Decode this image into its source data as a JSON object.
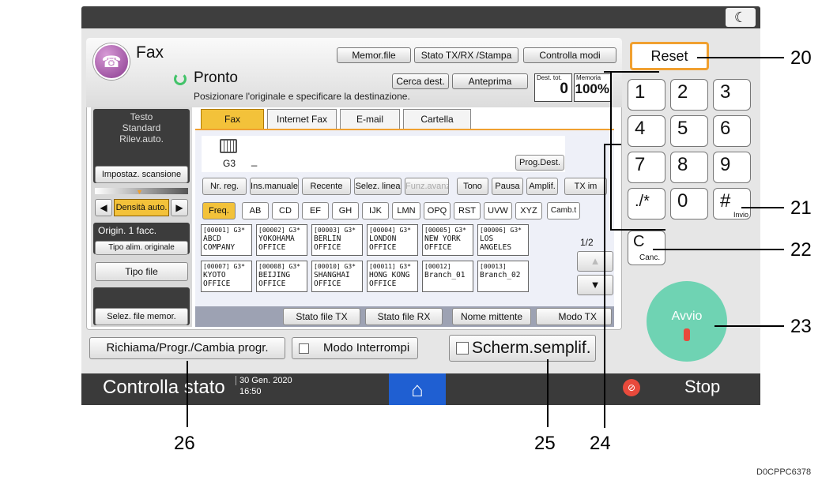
{
  "header": {
    "app": "Fax",
    "status": "Pronto",
    "message": "Posizionare l'originale e specificare la destinazione.",
    "dest_total_label": "Dest. tot.",
    "dest_total_value": "0",
    "memory_label": "Memoria",
    "memory_value": "100%"
  },
  "top_buttons": {
    "memor_file": "Memor.file",
    "stato": "Stato TX/RX /Stampa",
    "controlla": "Controlla modi"
  },
  "search": {
    "cerca": "Cerca dest.",
    "anteprima": "Anteprima"
  },
  "sidebar": {
    "scan_lines": [
      "Testo",
      "Standard",
      "Rilev.auto."
    ],
    "impostaz": "Impostaz. scansione",
    "densita": "Densità auto.",
    "origin": "Origin. 1 facc.",
    "tipo_alim": "Tipo alim. originale",
    "tipo_file": "Tipo file",
    "selez_file": "Selez. file memor."
  },
  "tabs": [
    "Fax",
    "Internet Fax",
    "E-mail",
    "Cartella"
  ],
  "entry": {
    "g3": "G3",
    "cursor": "_",
    "prog_dest": "Prog.Dest."
  },
  "func_buttons": [
    "Nr. reg.",
    "Ins.manuale",
    "Recente",
    "Selez. linea",
    "Funz.avanz.",
    "Tono",
    "Pausa",
    "Amplif.",
    "TX im"
  ],
  "alpha_tabs": [
    "Freq.",
    "AB",
    "CD",
    "EF",
    "GH",
    "IJK",
    "LMN",
    "OPQ",
    "RST",
    "UVW",
    "XYZ",
    "Camb.t"
  ],
  "destinations": [
    {
      "id": "[00001] G3*",
      "name": "ABCD COMPANY"
    },
    {
      "id": "[00002] G3*",
      "name": "YOKOHAMA OFFICE"
    },
    {
      "id": "[00003] G3*",
      "name": "BERLIN OFFICE"
    },
    {
      "id": "[00004] G3*",
      "name": "LONDON OFFICE"
    },
    {
      "id": "[00005] G3*",
      "name": "NEW YORK OFFICE"
    },
    {
      "id": "[00006] G3*",
      "name": "LOS ANGELES"
    },
    {
      "id": "[00007] G3*",
      "name": "KYOTO OFFICE"
    },
    {
      "id": "[00008] G3*",
      "name": "BEIJING OFFICE"
    },
    {
      "id": "[00010] G3*",
      "name": "SHANGHAI OFFICE"
    },
    {
      "id": "[00011] G3*",
      "name": "HONG KONG OFFICE"
    },
    {
      "id": "[00012]",
      "name": "Branch_01"
    },
    {
      "id": "[00013]",
      "name": "Branch_02"
    }
  ],
  "page_indicator": "1/2",
  "bottom_tabs": [
    "Stato file TX",
    "Stato file RX",
    "Nome mittente",
    "Modo TX"
  ],
  "lower_buttons": {
    "richiama": "Richiama/Progr./Cambia progr.",
    "interrompi": "Modo Interrompi",
    "scherm": "Scherm.semplif."
  },
  "status_bar": {
    "controlla": "Controlla stato",
    "date": "30 Gen. 2020",
    "time": "16:50",
    "stop": "Stop"
  },
  "keypad": {
    "reset": "Reset",
    "keys": [
      "1",
      "2",
      "3",
      "4",
      "5",
      "6",
      "7",
      "8",
      "9",
      "./*",
      "0",
      "#"
    ],
    "invio": "Invio",
    "clear": "C",
    "canc": "Canc.",
    "avvio": "Avvio"
  },
  "callouts": [
    "20",
    "21",
    "22",
    "23",
    "24",
    "25",
    "26"
  ],
  "figure_code": "D0CPPC6378",
  "colors": {
    "accent": "#f0a030",
    "start": "#6fd3b3",
    "status_ok": "#43c36a"
  }
}
